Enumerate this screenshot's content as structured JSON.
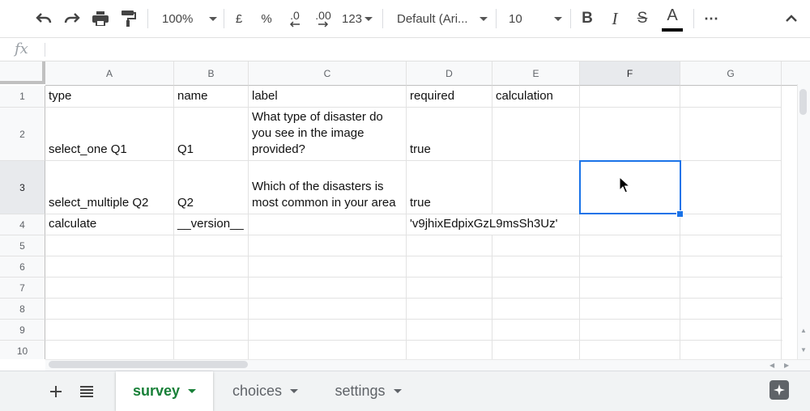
{
  "toolbar": {
    "zoom": "100%",
    "currency": "£",
    "percent": "%",
    "decrease_decimal": ".0",
    "increase_decimal": ".00",
    "number_format": "123",
    "font": "Default (Ari...",
    "font_size": "10",
    "bold": "B",
    "italic": "I",
    "strike": "S",
    "text_color": "A",
    "more": "⋯"
  },
  "formula_bar": {
    "fx": "fx",
    "value": ""
  },
  "columns": [
    "A",
    "B",
    "C",
    "D",
    "E",
    "F",
    "G"
  ],
  "rows": [
    "1",
    "2",
    "3",
    "4",
    "5",
    "6",
    "7",
    "8",
    "9",
    "10"
  ],
  "cells": {
    "r1": [
      "type",
      "name",
      "label",
      "required",
      "calculation",
      "",
      ""
    ],
    "r2": [
      "select_one Q1",
      "Q1",
      "What type of disaster do you see in the image provided?",
      "true",
      "",
      "",
      ""
    ],
    "r3": [
      "select_multiple Q2",
      "Q2",
      "Which of the disasters is most common in your area",
      "true",
      "",
      "",
      ""
    ],
    "r4": [
      "calculate",
      "__version__",
      "",
      "'v9jhixEdpixGzL9msSh3Uz'",
      "",
      "",
      ""
    ]
  },
  "selected_cell": "F3",
  "tabs": [
    {
      "label": "survey",
      "active": true
    },
    {
      "label": "choices",
      "active": false
    },
    {
      "label": "settings",
      "active": false
    }
  ],
  "colors": {
    "accent": "#1a73e8",
    "active_tab": "#188038"
  }
}
